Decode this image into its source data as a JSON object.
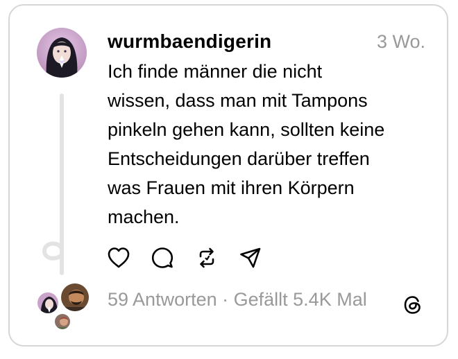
{
  "post": {
    "username": "wurmbaendigerin",
    "time": "3 Wo.",
    "text_lines": [
      "Ich finde männer die nicht",
      "wissen, dass man mit Tampons",
      "pinkeln gehen kann, sollten keine",
      "Entscheidungen darüber treffen",
      "was Frauen mit ihren Körpern",
      "machen."
    ]
  },
  "actions": {
    "icons": [
      "heart-icon",
      "comment-icon",
      "repost-icon",
      "share-icon"
    ]
  },
  "footer": {
    "replies": "59 Antworten",
    "separator": " · ",
    "likes": "Gefällt 5.4K Mal",
    "logo": "threads-logo-icon"
  },
  "colors": {
    "muted": "#999999",
    "border": "#d6d6d6",
    "thread_line": "#e3e3e3"
  }
}
